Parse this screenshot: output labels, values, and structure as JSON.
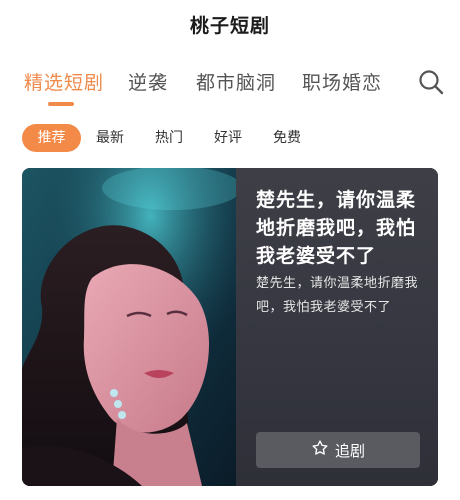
{
  "header": {
    "title": "桃子短剧"
  },
  "tabs": [
    {
      "label": "精选短剧",
      "active": true
    },
    {
      "label": "逆袭",
      "active": false
    },
    {
      "label": "都市脑洞",
      "active": false
    },
    {
      "label": "职场婚恋",
      "active": false
    }
  ],
  "filters": [
    {
      "label": "推荐",
      "active": true
    },
    {
      "label": "最新",
      "active": false
    },
    {
      "label": "热门",
      "active": false
    },
    {
      "label": "好评",
      "active": false
    },
    {
      "label": "免费",
      "active": false
    }
  ],
  "card": {
    "title": "楚先生，请你温柔地折磨我吧，我怕我老婆受不了",
    "description": "楚先生，请你温柔地折磨我吧，我怕我老婆受不了",
    "follow_label": "追剧"
  },
  "colors": {
    "accent": "#f08a4b",
    "chip_active": "#f48a48",
    "card_bg": "#3a3b42"
  },
  "icons": {
    "search": "search-icon",
    "follow": "star-outline-icon"
  }
}
